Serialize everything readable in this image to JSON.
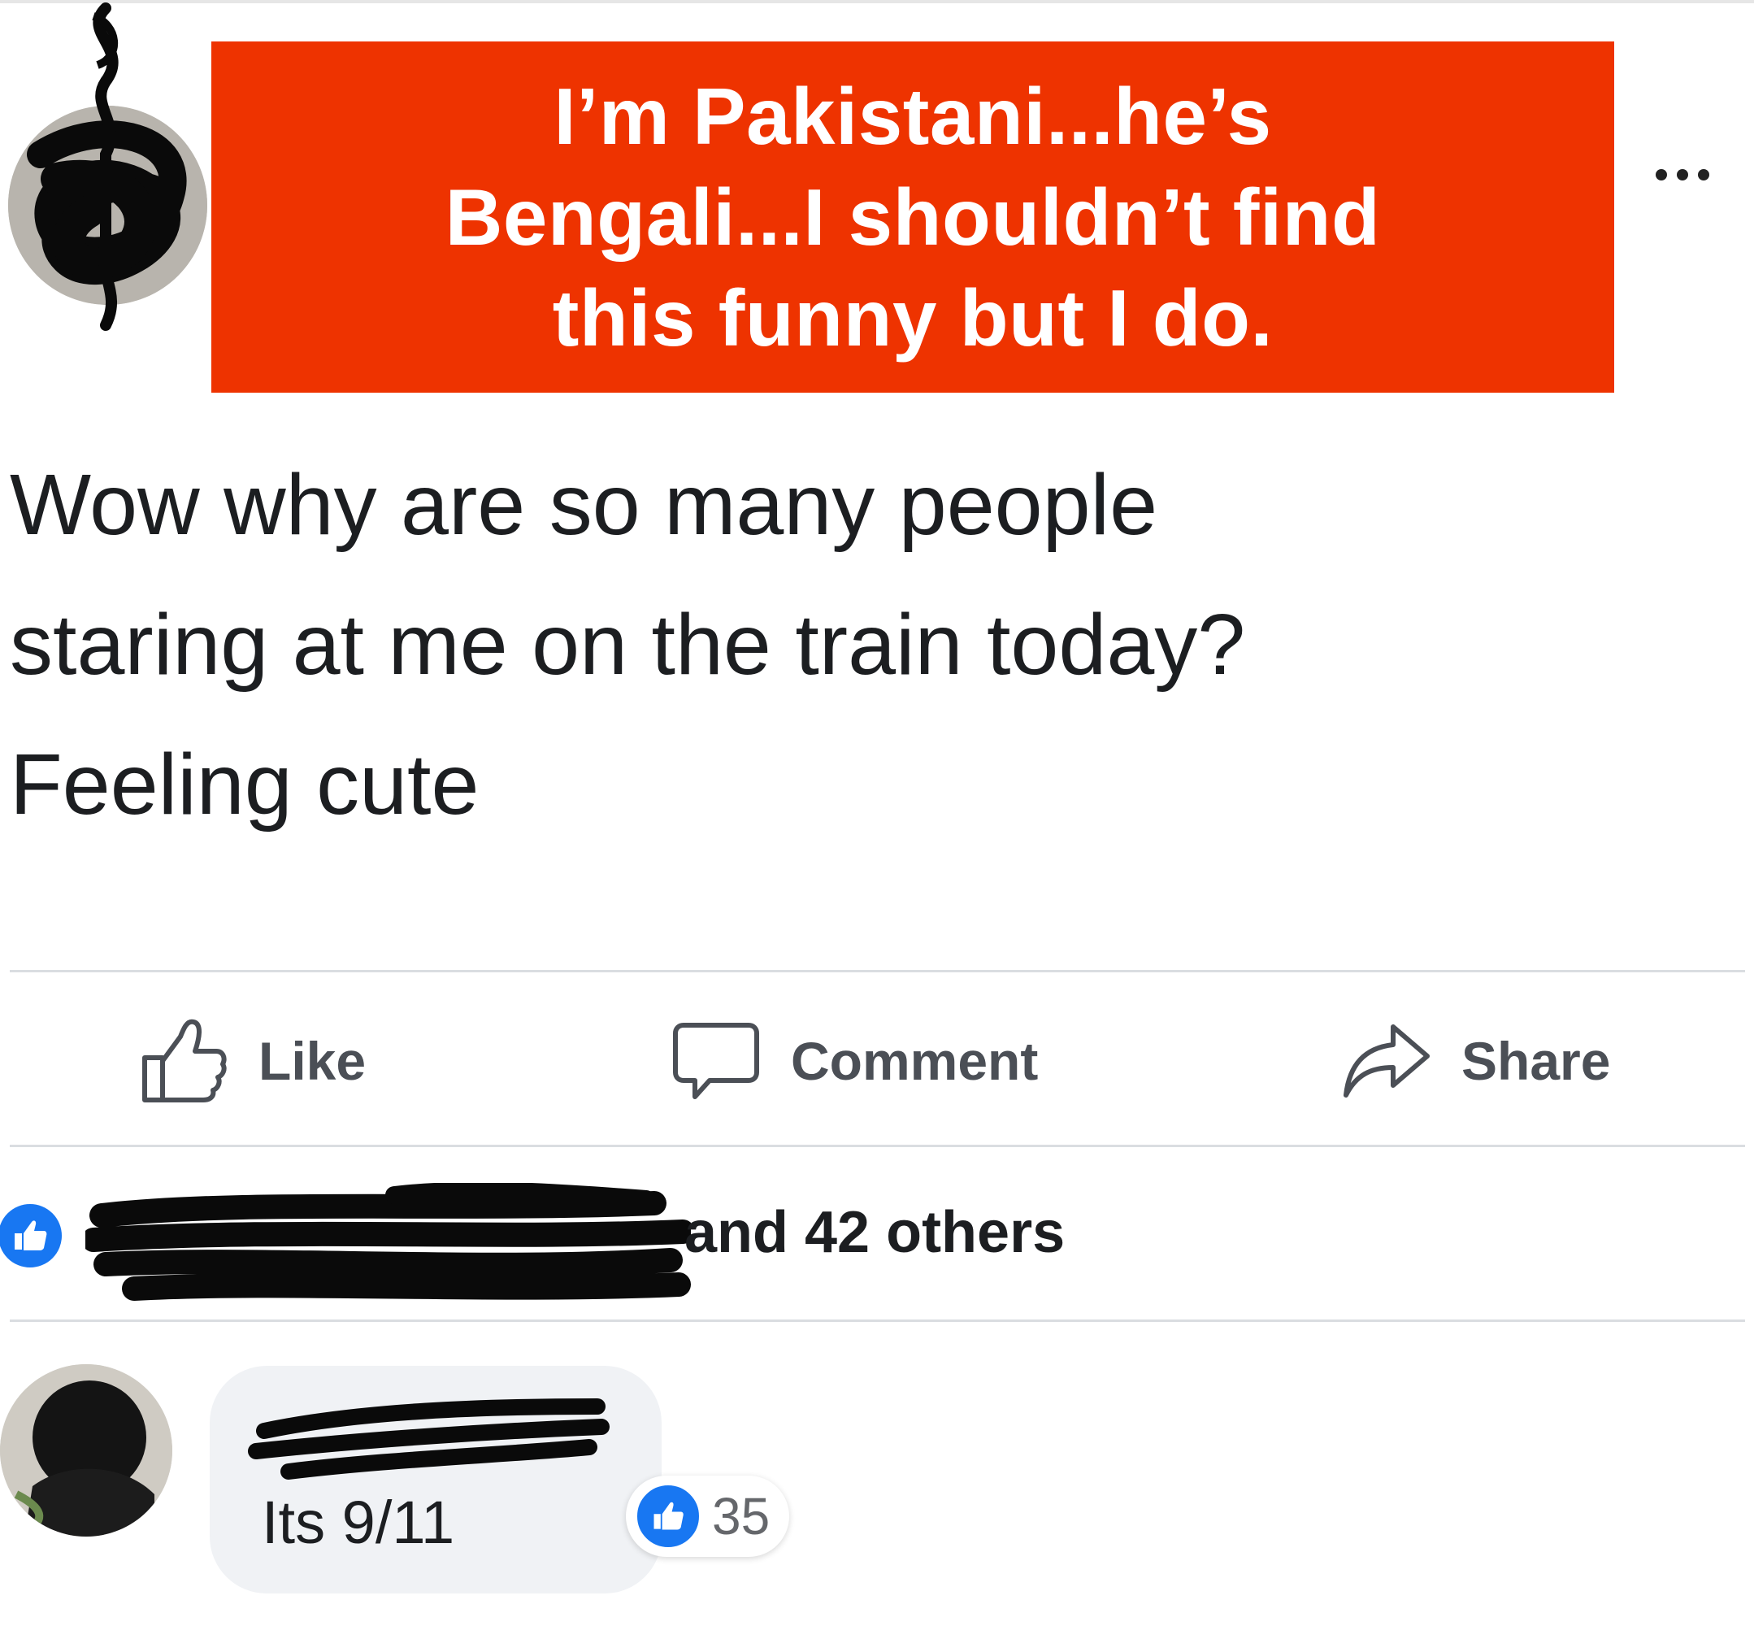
{
  "caption": {
    "lines": [
      "I’m Pakistani...he’s",
      "Bengali...I shouldn’t find",
      "this funny but I do."
    ]
  },
  "post": {
    "text_lines": [
      "Wow why are so many people",
      "staring at me on the train today?",
      "Feeling cute"
    ],
    "more_icon": "more-horizontal-icon"
  },
  "actions": [
    {
      "label": "Like",
      "icon": "thumbs-up-icon"
    },
    {
      "label": "Comment",
      "icon": "comment-bubble-icon"
    },
    {
      "label": "Share",
      "icon": "share-arrow-icon"
    }
  ],
  "reactions": {
    "summary": "and 42 others",
    "icon": "like-reaction-icon"
  },
  "comment": {
    "text": "Its 9/11",
    "reaction_count": "35",
    "reaction_icon": "like-reaction-icon"
  },
  "colors": {
    "banner": "#ee3300",
    "banner_text": "#ffffff",
    "like_blue": "#1877f2",
    "action_gray": "#4b4f56"
  }
}
